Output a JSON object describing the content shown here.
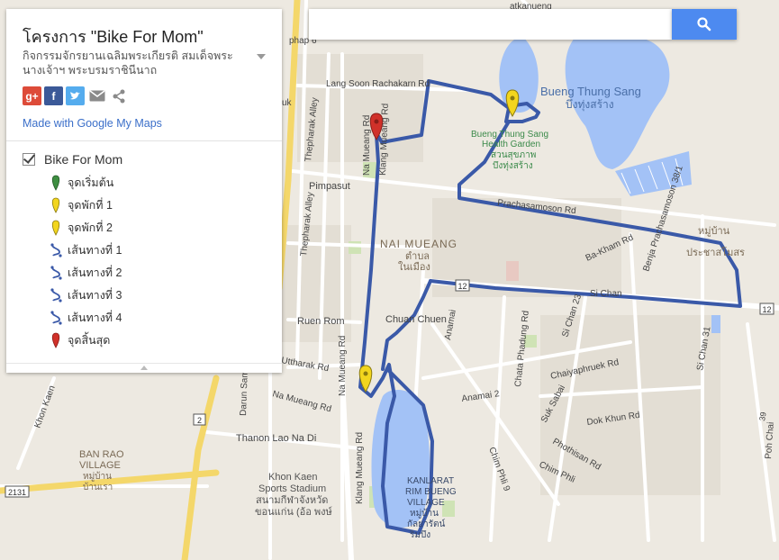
{
  "search": {
    "placeholder": ""
  },
  "panel": {
    "title": "โครงการ \"Bike For Mom\"",
    "description": "กิจกรรมจักรยานเฉลิมพระเกียรติ สมเด็จพระนางเจ้าฯ พระบรมราชินีนาถ",
    "share_icons": [
      "google-plus-icon",
      "facebook-icon",
      "twitter-icon",
      "email-icon",
      "share-icon"
    ],
    "google_plus_label": "g+",
    "facebook_label": "f",
    "made_with": "Made with Google My Maps",
    "layer": {
      "name": "Bike For Mom",
      "checked": true,
      "items": [
        {
          "label": "จุดเริ่มต้น",
          "icon": "green-marker-icon"
        },
        {
          "label": "จุดพักที่ 1",
          "icon": "yellow-marker-icon"
        },
        {
          "label": "จุดพักที่ 2",
          "icon": "yellow-marker-icon"
        },
        {
          "label": "เส้นทางที่ 1",
          "icon": "route-icon"
        },
        {
          "label": "เส้นทางที่ 2",
          "icon": "route-icon"
        },
        {
          "label": "เส้นทางที่ 3",
          "icon": "route-icon"
        },
        {
          "label": "เส้นทางที่ 4",
          "icon": "route-icon"
        },
        {
          "label": "จุดสิ้นสุด",
          "icon": "red-marker-icon"
        }
      ]
    }
  },
  "colors": {
    "route": "#3a59a8",
    "water": "#a3c2f6",
    "main_road": "#f4d76a",
    "marker_green": "#3e8e41",
    "marker_yellow": "#f2d51e",
    "marker_red": "#d0312a",
    "search_button": "#4d8af0"
  },
  "map": {
    "labels": {
      "bueng_thung_sang": "Bueng Thung Sang",
      "bueng_thung_sang_th": "บึงทุ่งสร้าง",
      "health_garden_1": "Bueng Thung Sang",
      "health_garden_2": "Health Garden",
      "health_garden_th1": "สวนสุขภาพ",
      "health_garden_th2": "บึงทุ่งสร้าง",
      "nai_mueang": "NAI MUEANG",
      "nai_mueang_th1": "ตำบล",
      "nai_mueang_th2": "ในเมือง",
      "ban_rao_1": "BAN RAO",
      "ban_rao_2": "VILLAGE",
      "ban_rao_th1": "หมู่บ้าน",
      "ban_rao_th2": "บ้านเรา",
      "kanlarat_1": "KANLARAT",
      "kanlarat_2": "RIM BUENG",
      "kanlarat_3": "VILLAGE",
      "kanlarat_th1": "หมู่บ้าน",
      "kanlarat_th2": "กัลยารัตน์",
      "kanlarat_th3": "ริมบึง",
      "stadium_1": "Khon Kaen",
      "stadium_2": "Sports Stadium",
      "stadium_th1": "สนามกีฬาจังหวัด",
      "stadium_th2": "ขอนแก่น (อ้อ พงษ์",
      "prachasamoson_th1": "หมู่บ้าน",
      "prachasamoson_th2": "ประชาสโมสร",
      "pimpasut": "Pimpasut",
      "ruen_rom": "Ruen Rom",
      "chuan_chuen": "Chuan Chuen",
      "thanon_lao_na_di": "Thanon Lao Na Di",
      "lang_soon": "Lang Soon Rachakarn Rd",
      "phap": "phap 6",
      "uk": "uk",
      "thepharak_alley_1": "Thepharak Alley",
      "thepharak_alley_2": "Thepharak Alley",
      "na_mueang_rd_1": "Na Mueang Rd",
      "na_mueang_rd_2": "Na Mueang Rd",
      "klang_mueang_rd_1": "Klang Mueang Rd",
      "klang_mueang_rd_2": "Klang Mueang Rd",
      "prachasamoson_rd": "Prachasamoson Rd",
      "benja_rd": "Benja Prachasamoson 38/1",
      "ba_kham_rd": "Ba-Kham Rd",
      "si_chan": "Si Chan",
      "si_chan_23": "Si Chan 23",
      "si_chan_31": "Si Chan 31",
      "chata_phadung": "Chata Phadung Rd",
      "chaiyaphruek": "Chaiyaphruek Rd",
      "anamai": "Anamai",
      "anamai_2": "Anamai 2",
      "suk_sabai": "Suk Sabai",
      "dok_khun": "Dok Khun Rd",
      "phothisan": "Phothisan Rd",
      "chim_phli": "Chim Phli",
      "chim_phli_9": "Chim Phli 9",
      "poh_chai": "Poh Chai",
      "khon_kaen": "Khon Kaen",
      "darun": "Darun Sam",
      "uttharak": "Uttharak Rd",
      "na_mueang_short": "Na Mueang Rd",
      "atkanueng": "atkanueng",
      "road_12_a": "12",
      "road_12_b": "12",
      "road_2": "2",
      "road_2131": "2131",
      "num_39": "39"
    }
  }
}
